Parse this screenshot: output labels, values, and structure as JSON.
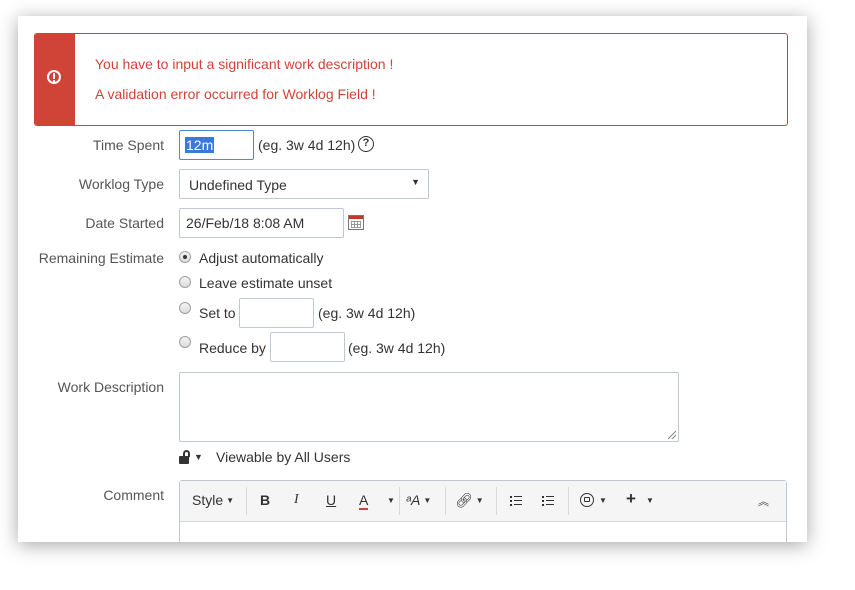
{
  "errors": {
    "message_1": "You have to input a significant work description !",
    "message_2": "A validation error occurred for Worklog Field !"
  },
  "form": {
    "time_spent": {
      "label": "Time Spent",
      "value": "12m",
      "hint": "(eg. 3w 4d 12h)"
    },
    "worklog_type": {
      "label": "Worklog Type",
      "selected": "Undefined Type"
    },
    "date_started": {
      "label": "Date Started",
      "value": "26/Feb/18 8:08 AM"
    },
    "remaining_estimate": {
      "label": "Remaining Estimate",
      "options": [
        {
          "label": "Adjust automatically",
          "checked": true
        },
        {
          "label": "Leave estimate unset",
          "checked": false
        },
        {
          "label": "Set to",
          "checked": false,
          "hint": "(eg. 3w 4d 12h)"
        },
        {
          "label": "Reduce by",
          "checked": false,
          "hint": "(eg. 3w 4d 12h)"
        }
      ]
    },
    "work_description": {
      "label": "Work Description",
      "value": ""
    },
    "visibility": {
      "label": "Viewable by All Users"
    },
    "comment": {
      "label": "Comment",
      "toolbar": {
        "style": "Style",
        "bold": "B",
        "italic": "I",
        "underline": "U",
        "text_color": "A",
        "more_format": "ᵃA"
      }
    }
  },
  "colors": {
    "error": "#d04437",
    "selection": "#3b78d8",
    "border": "#c1c7d0"
  }
}
